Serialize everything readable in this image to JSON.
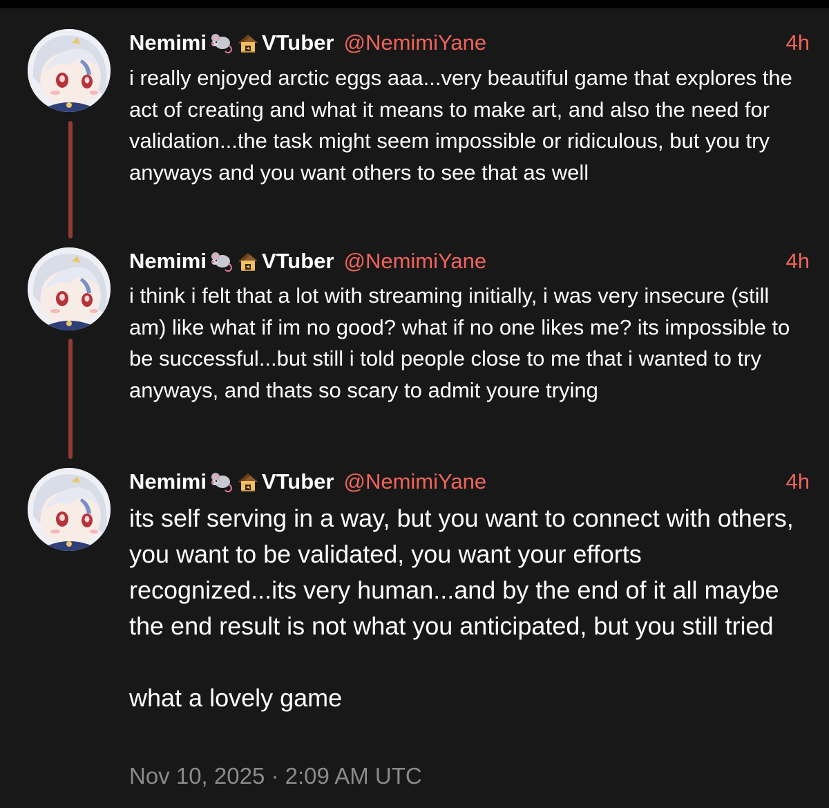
{
  "colors": {
    "background": "#181818",
    "text": "#ffffff",
    "accent": "#f0645a",
    "thread_line": "#8f3b33",
    "muted": "#8a8a8a"
  },
  "posts": [
    {
      "display_name": "Nemimi",
      "emoji_icons": [
        "rat-icon",
        "house-icon"
      ],
      "role": "VTuber",
      "handle": "@NemimiYane",
      "time": "4h",
      "text": "i really enjoyed arctic eggs aaa...very beautiful game that explores the act of creating and what it means to make art, and also the need for validation...the task might seem impossible or ridiculous, but you try anyways and you want others to see that as well"
    },
    {
      "display_name": "Nemimi",
      "emoji_icons": [
        "rat-icon",
        "house-icon"
      ],
      "role": "VTuber",
      "handle": "@NemimiYane",
      "time": "4h",
      "text": "i think i felt that a lot with streaming initially, i was very insecure (still am) like what if im no good? what if no one likes me? its impossible to be successful...but still i told people close to me that i wanted to try anyways, and thats so scary to admit youre trying"
    },
    {
      "display_name": "Nemimi",
      "emoji_icons": [
        "rat-icon",
        "house-icon"
      ],
      "role": "VTuber",
      "handle": "@NemimiYane",
      "time": "4h",
      "text": "its self serving in a way, but you want to connect with others, you want to be validated, you want your efforts recognized...its very human...and by the end of it all maybe the end result is not what you anticipated, but you still tried\n\nwhat a lovely game"
    }
  ],
  "dateline": "Nov 10, 2025 · 2:09 AM UTC"
}
